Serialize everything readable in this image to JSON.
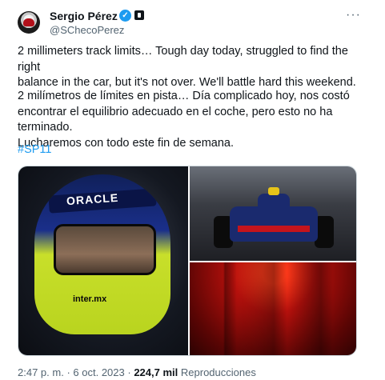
{
  "author": {
    "name": "Sergio Pérez",
    "handle": "@SChecoPerez"
  },
  "tweet": {
    "text_en": "2 millimeters track limits… Tough day today, struggled to find the right\nbalance in the car, but it's not over. We'll battle hard this weekend.",
    "text_es": "2 milímetros de límites en pista… Día complicado hoy, nos costó\nencontrar el equilibrio adecuado en el coche, pero esto no ha terminado.\nLucharemos con todo este fin de semana.",
    "hashtag": "#SP11"
  },
  "media": {
    "left_helmet_text": "ORACLE",
    "left_chin_text": "inter.mx"
  },
  "meta": {
    "time": "2:47 p. m.",
    "sep1": "·",
    "date": "6 oct. 2023",
    "sep2": "·",
    "views": "224,7 mil",
    "views_label": "Reproducciones"
  },
  "icons": {
    "verified": "verified-check-icon",
    "affiliation": "affiliation-badge-icon",
    "more": "more-options-icon"
  },
  "colors": {
    "accent": "#1d9bf0",
    "text": "#0f1419",
    "muted": "#536471"
  }
}
